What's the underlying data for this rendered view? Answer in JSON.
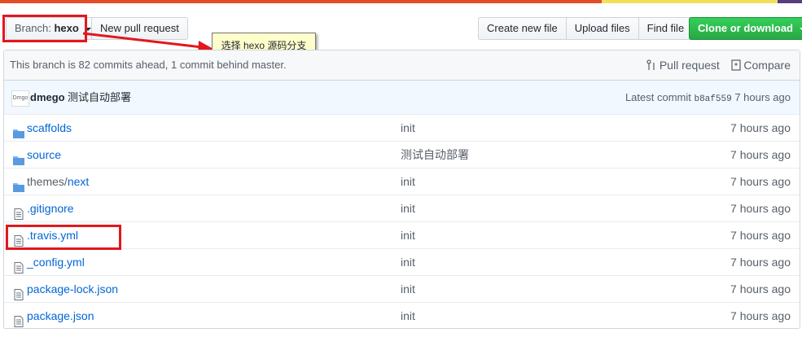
{
  "colors": {
    "accent": "#0366d6",
    "green": "#28a745",
    "annotation_red": "#e3171e",
    "tooltip_bg": "#ffffcc"
  },
  "lang_bar": [
    {
      "color": "#e34c26",
      "percent": 75
    },
    {
      "color": "#f1e05a",
      "percent": 22
    },
    {
      "color": "#563d7c",
      "percent": 3
    }
  ],
  "branch": {
    "label": "Branch:",
    "name": "hexo"
  },
  "new_pr": "New pull request",
  "file_actions": {
    "create": "Create new file",
    "upload": "Upload files",
    "find": "Find file"
  },
  "clone": "Clone or download",
  "annotation": {
    "text": "选择 hexo 源码分支"
  },
  "status": {
    "text": "This branch is 82 commits ahead, 1 commit behind master.",
    "pull_request": "Pull request",
    "compare": "Compare"
  },
  "latest_commit": {
    "avatar_text": "Dmgo",
    "author": "dmego",
    "message": "测试自动部署",
    "label": "Latest commit",
    "sha": "b8af559",
    "age": "7 hours ago"
  },
  "files": [
    {
      "type": "folder-icon",
      "name": "scaffolds",
      "suffix": "",
      "message": "init",
      "age": "7 hours ago"
    },
    {
      "type": "folder-icon",
      "name": "source",
      "suffix": "",
      "message": "测试自动部署",
      "age": "7 hours ago"
    },
    {
      "type": "folder-icon",
      "name": "themes/",
      "suffix": "next",
      "message": "init",
      "age": "7 hours ago"
    },
    {
      "type": "file-icon",
      "name": ".gitignore",
      "suffix": "",
      "message": "init",
      "age": "7 hours ago"
    },
    {
      "type": "file-icon",
      "name": ".travis.yml",
      "suffix": "",
      "message": "init",
      "age": "7 hours ago"
    },
    {
      "type": "file-icon",
      "name": "_config.yml",
      "suffix": "",
      "message": "init",
      "age": "7 hours ago"
    },
    {
      "type": "file-icon",
      "name": "package-lock.json",
      "suffix": "",
      "message": "init",
      "age": "7 hours ago"
    },
    {
      "type": "file-icon",
      "name": "package.json",
      "suffix": "",
      "message": "init",
      "age": "7 hours ago"
    }
  ]
}
